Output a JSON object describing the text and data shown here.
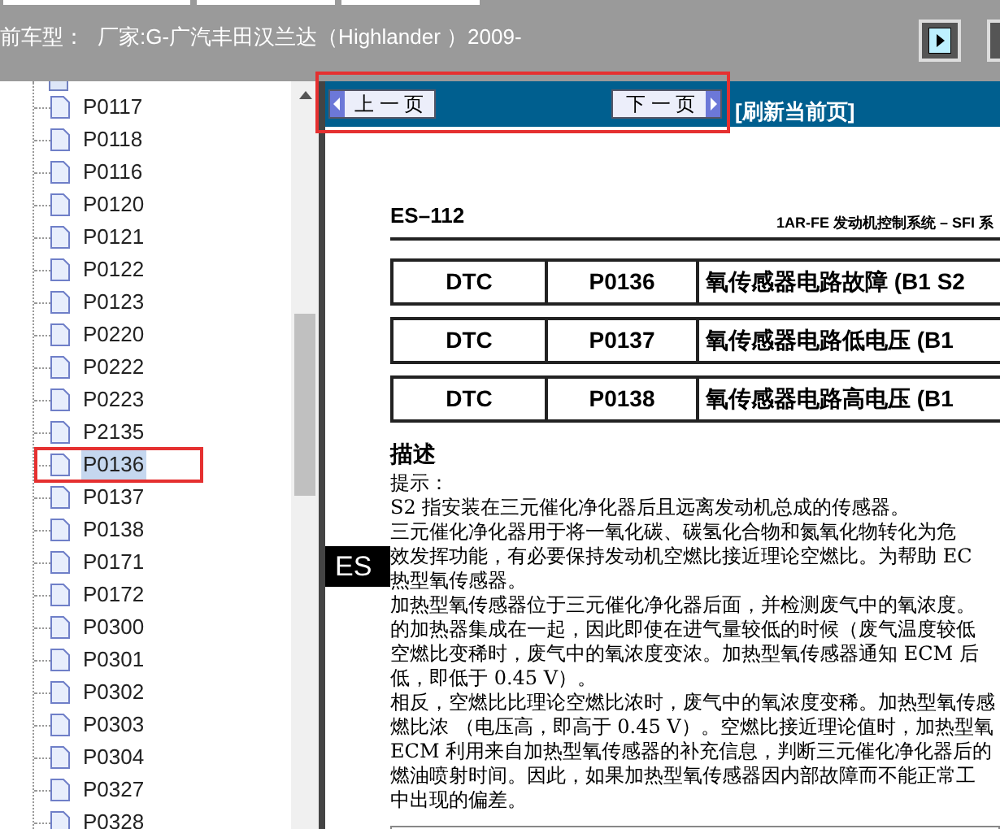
{
  "header": {
    "label": "前车型：",
    "vehicle": "厂家:G-广汽丰田汉兰达（Highlander ）2009-"
  },
  "tree": {
    "items": [
      {
        "label": "P0117",
        "selected": false
      },
      {
        "label": "P0118",
        "selected": false
      },
      {
        "label": "P0116",
        "selected": false
      },
      {
        "label": "P0120",
        "selected": false
      },
      {
        "label": "P0121",
        "selected": false
      },
      {
        "label": "P0122",
        "selected": false
      },
      {
        "label": "P0123",
        "selected": false
      },
      {
        "label": "P0220",
        "selected": false
      },
      {
        "label": "P0222",
        "selected": false
      },
      {
        "label": "P0223",
        "selected": false
      },
      {
        "label": "P2135",
        "selected": false
      },
      {
        "label": "P0136",
        "selected": true
      },
      {
        "label": "P0137",
        "selected": false
      },
      {
        "label": "P0138",
        "selected": false
      },
      {
        "label": "P0171",
        "selected": false
      },
      {
        "label": "P0172",
        "selected": false
      },
      {
        "label": "P0300",
        "selected": false
      },
      {
        "label": "P0301",
        "selected": false
      },
      {
        "label": "P0302",
        "selected": false
      },
      {
        "label": "P0303",
        "selected": false
      },
      {
        "label": "P0304",
        "selected": false
      },
      {
        "label": "P0327",
        "selected": false
      },
      {
        "label": "P0328",
        "selected": false
      }
    ]
  },
  "nav": {
    "prev": "上 一 页",
    "next": "下 一 页",
    "refresh": "[刷新当前页]"
  },
  "document": {
    "page": "ES–112",
    "section": "1AR-FE 发动机控制系统 – SFI 系",
    "side_tab": "ES",
    "dtc_rows": [
      {
        "label": "DTC",
        "code": "P0136",
        "title": "氧传感器电路故障 (B1 S2"
      },
      {
        "label": "DTC",
        "code": "P0137",
        "title": "氧传感器电路低电压 (B1"
      },
      {
        "label": "DTC",
        "code": "P0138",
        "title": "氧传感器电路高电压 (B1"
      }
    ],
    "heading": "描述",
    "lines": [
      "提示：",
      "S2 指安装在三元催化净化器后且远离发动机总成的传感器。",
      "三元催化净化器用于将一氧化碳、碳氢化合物和氮氧化物转化为危",
      "效发挥功能，有必要保持发动机空燃比接近理论空燃比。为帮助 EC",
      "热型氧传感器。",
      "加热型氧传感器位于三元催化净化器后面，并检测废气中的氧浓度。",
      "的加热器集成在一起，因此即使在进气量较低的时候（废气温度较低",
      "空燃比变稀时，废气中的氧浓度变浓。加热型氧传感器通知 ECM 后",
      "低，即低于 0.45 V）。",
      "相反，空燃比比理论空燃比浓时，废气中的氧浓度变稀。加热型氧传感",
      "燃比浓 （电压高，即高于 0.45 V）。空燃比接近理论值时，加热型氧",
      "ECM 利用来自加热型氧传感器的补充信息，判断三元催化净化器后的",
      "燃油喷射时间。因此，如果加热型氧传感器因内部故障而不能正常工",
      "中出现的偏差。"
    ]
  }
}
